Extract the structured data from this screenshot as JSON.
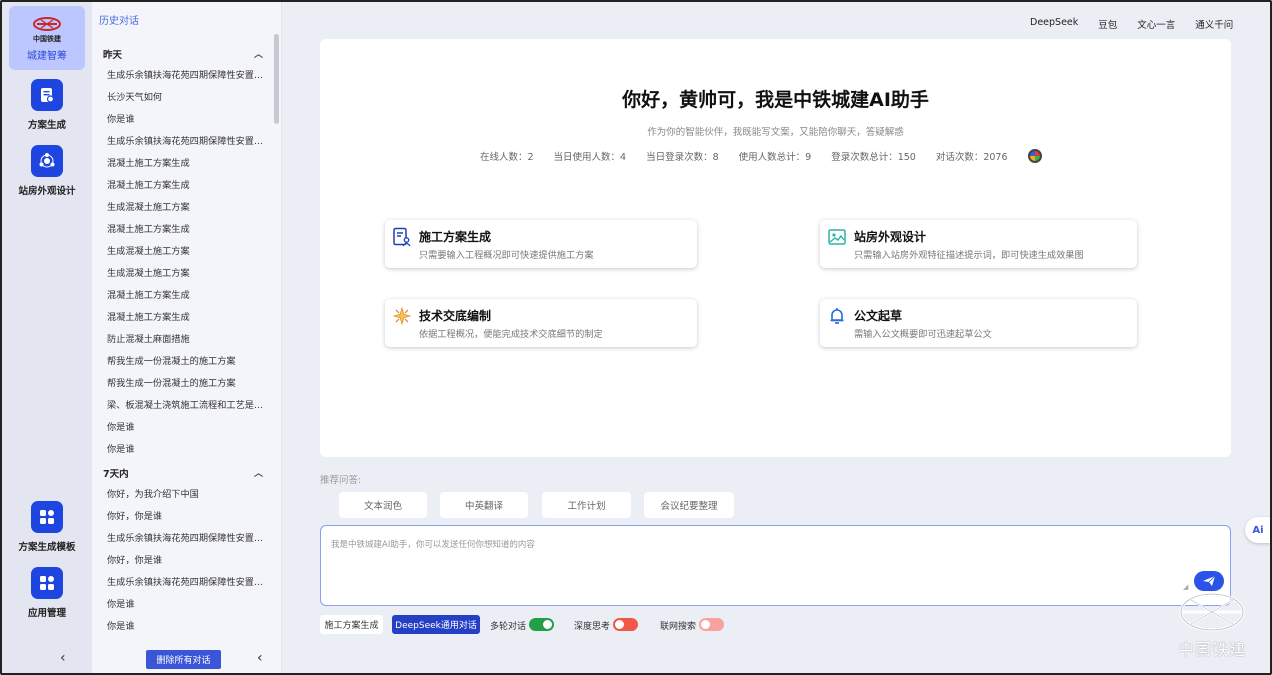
{
  "rail": {
    "logo_small": "中国铁建",
    "logo_label": "城建智筹",
    "items": [
      {
        "label": "方案生成",
        "icon": "document-icon"
      },
      {
        "label": "站房外观设计",
        "icon": "gear-cluster-icon"
      },
      {
        "label": "方案生成模板",
        "icon": "grid-icon"
      },
      {
        "label": "应用管理",
        "icon": "grid-icon"
      }
    ],
    "collapse": "‹"
  },
  "history": {
    "title": "历史对话",
    "groups": [
      {
        "label": "昨天",
        "items": [
          "生成乐余镇扶海花苑四期保障性安置房项目施工方案",
          "长沙天气如何",
          "你是谁",
          "生成乐余镇扶海花苑四期保障性安置房项目施工方案",
          "混凝土施工方案生成",
          "混凝土施工方案生成",
          "生成混凝土施工方案",
          "混凝土施工方案生成",
          "生成混凝土施工方案",
          "生成混凝土施工方案",
          "混凝土施工方案生成",
          "混凝土施工方案生成",
          "防止混凝土麻面措施",
          "帮我生成一份混凝土的施工方案",
          "帮我生成一份混凝土的施工方案",
          "梁、板混凝土浇筑施工流程和工艺是什么",
          "你是谁",
          "你是谁"
        ]
      },
      {
        "label": "7天内",
        "items": [
          "你好，为我介绍下中国",
          "你好，你是谁",
          "生成乐余镇扶海花苑四期保障性安置房项目施工方案",
          "你好，你是谁",
          "生成乐余镇扶海花苑四期保障性安置房项目施工方案",
          "你是谁",
          "你是谁"
        ]
      }
    ],
    "delete_all": "删除所有对话",
    "collapse": "‹"
  },
  "topnav": [
    "DeepSeek",
    "豆包",
    "文心一言",
    "通义千问"
  ],
  "welcome": {
    "greeting": "你好，黄帅可，我是中铁城建AI助手",
    "subtitle": "作为你的智能伙伴，我既能写文案，又能陪你聊天，答疑解惑",
    "stats": [
      "在线人数：2",
      "当日使用人数：4",
      "当日登录次数：8",
      "使用人数总计：9",
      "登录次数总计：150",
      "对话次数：2076"
    ]
  },
  "features": [
    {
      "title": "施工方案生成",
      "desc": "只需要输入工程概况即可快速提供施工方案",
      "icon": "document-person-icon"
    },
    {
      "title": "站房外观设计",
      "desc": "只需输入站房外观特征描述提示词，即可快速生成效果图",
      "icon": "image-icon"
    },
    {
      "title": "技术交底编制",
      "desc": "依据工程概况，便能完成技术交底细节的制定",
      "icon": "sparkle-icon"
    },
    {
      "title": "公文起草",
      "desc": "需输入公文概要即可迅速起草公文",
      "icon": "bell-icon"
    }
  ],
  "suggestions": {
    "label": "推荐问答:",
    "chips": [
      "文本润色",
      "中英翻译",
      "工作计划",
      "会议纪要整理"
    ]
  },
  "input": {
    "placeholder": "我是中铁城建AI助手，你可以发送任何你想知道的内容",
    "value": ""
  },
  "toolbar": {
    "mode_plan": "施工方案生成",
    "mode_deepseek": "DeepSeek通用对话",
    "toggles": [
      {
        "label": "多轮对话",
        "on": true
      },
      {
        "label": "深度思考",
        "on": false
      },
      {
        "label": "联网搜索",
        "on": false
      }
    ]
  },
  "side_widget": "Ai",
  "watermark": "中国铁建",
  "colors": {
    "accent": "#1f45e0",
    "toggle_on": "#22a046",
    "toggle_off": "#f0584a"
  }
}
